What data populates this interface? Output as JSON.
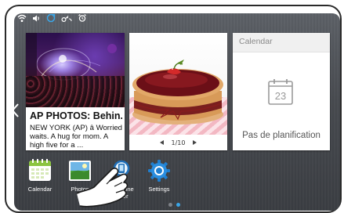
{
  "status_icons": [
    "wifi-icon",
    "volume-icon",
    "sync-icon",
    "key-sync-icon",
    "alarm-icon"
  ],
  "news": {
    "title": "AP PHOTOS: Behin...",
    "body": "NEW YORK  (AP) â Worried waits. A hug for mom. A high five for a ..."
  },
  "photo": {
    "pager_text": "1/10",
    "current_page": 1,
    "total_pages": 10
  },
  "calendar": {
    "title": "Calendar",
    "date_number": "23",
    "empty_text": "Pas de planification"
  },
  "dock": [
    {
      "label": "Calendar",
      "icon": "calendar-app-icon"
    },
    {
      "label": "Photos",
      "icon": "photos-app-icon"
    },
    {
      "label": "Téléphone Finder",
      "icon": "phone-finder-app-icon"
    },
    {
      "label": "Settings",
      "icon": "settings-app-icon"
    }
  ],
  "colors": {
    "accent": "#3aa6e8",
    "settings_blue": "#1f7fd0",
    "background": "#474a4f"
  }
}
